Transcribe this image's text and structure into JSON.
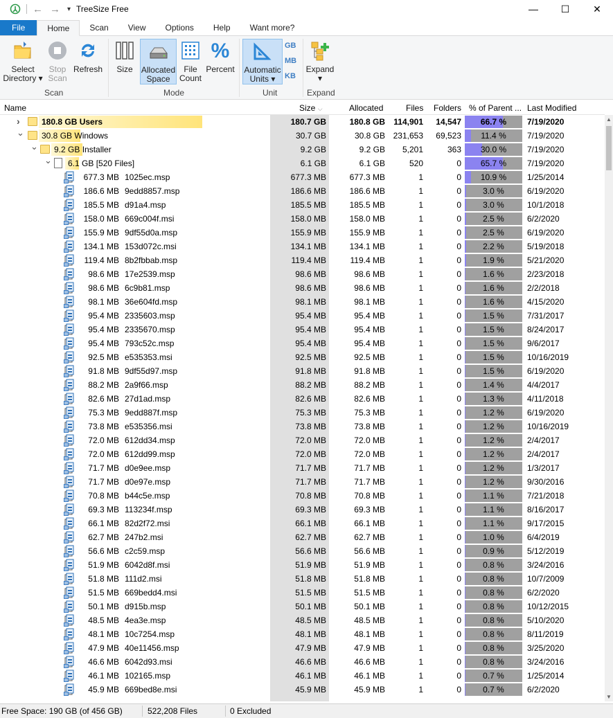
{
  "titlebar": {
    "title": "TreeSize Free",
    "back": "←",
    "forward": "→",
    "qat": "▾",
    "minimize": "—",
    "maximize": "☐",
    "close": "✕"
  },
  "tabs": [
    "File",
    "Home",
    "Scan",
    "View",
    "Options",
    "Help",
    "Want more?"
  ],
  "ribbon": {
    "select_directory": "Select\nDirectory ▾",
    "stop_scan": "Stop\nScan",
    "refresh": "Refresh",
    "size": "Size",
    "allocated_space": "Allocated\nSpace",
    "file_count": "File\nCount",
    "percent": "Percent",
    "automatic_units": "Automatic\nUnits ▾",
    "unit_gb": "GB",
    "unit_mb": "MB",
    "unit_kb": "KB",
    "expand": "Expand\n▾",
    "groups": {
      "scan": "Scan",
      "mode": "Mode",
      "unit": "Unit",
      "expand": "Expand"
    }
  },
  "columns": {
    "name": "Name",
    "size": "Size",
    "allocated": "Allocated",
    "files": "Files",
    "folders": "Folders",
    "percent": "% of Parent ...",
    "modified": "Last Modified"
  },
  "tree": [
    {
      "label": "180.8 GB  Users",
      "size": "180.7 GB",
      "allocated": "180.8 GB",
      "files": "114,901",
      "folders": "14,547",
      "percent": "66.7 %",
      "pct": 66.7,
      "modified": "7/19/2020",
      "level": 0,
      "kind": "folder",
      "expander": "›",
      "bold": true
    },
    {
      "label": "30.8 GB  Windows",
      "size": "30.7 GB",
      "allocated": "30.8 GB",
      "files": "231,653",
      "folders": "69,523",
      "percent": "11.4 %",
      "pct": 11.4,
      "modified": "7/19/2020",
      "level": 0,
      "kind": "folder",
      "expander": "⌄"
    },
    {
      "label": "9.2 GB  Installer",
      "size": "9.2 GB",
      "allocated": "9.2 GB",
      "files": "5,201",
      "folders": "363",
      "percent": "30.0 %",
      "pct": 30.0,
      "modified": "7/19/2020",
      "level": 1,
      "kind": "folder",
      "expander": "⌄"
    },
    {
      "label": "6.1 GB  [520 Files]",
      "size": "6.1 GB",
      "allocated": "6.1 GB",
      "files": "520",
      "folders": "0",
      "percent": "65.7 %",
      "pct": 65.7,
      "modified": "7/19/2020",
      "level": 2,
      "kind": "files",
      "expander": "⌄"
    }
  ],
  "files": [
    [
      "677.3 MB",
      "1025ec.msp",
      "10.9 %",
      "1/25/2014"
    ],
    [
      "186.6 MB",
      "9edd8857.msp",
      "3.0 %",
      "6/19/2020"
    ],
    [
      "185.5 MB",
      "d91a4.msp",
      "3.0 %",
      "10/1/2018"
    ],
    [
      "158.0 MB",
      "669c004f.msi",
      "2.5 %",
      "6/2/2020"
    ],
    [
      "155.9 MB",
      "9df55d0a.msp",
      "2.5 %",
      "6/19/2020"
    ],
    [
      "134.1 MB",
      "153d072c.msi",
      "2.2 %",
      "5/19/2018"
    ],
    [
      "119.4 MB",
      "8b2fbbab.msp",
      "1.9 %",
      "5/21/2020"
    ],
    [
      "98.6 MB",
      "17e2539.msp",
      "1.6 %",
      "2/23/2018"
    ],
    [
      "98.6 MB",
      "6c9b81.msp",
      "1.6 %",
      "2/2/2018"
    ],
    [
      "98.1 MB",
      "36e604fd.msp",
      "1.6 %",
      "4/15/2020"
    ],
    [
      "95.4 MB",
      "2335603.msp",
      "1.5 %",
      "7/31/2017"
    ],
    [
      "95.4 MB",
      "2335670.msp",
      "1.5 %",
      "8/24/2017"
    ],
    [
      "95.4 MB",
      "793c52c.msp",
      "1.5 %",
      "9/6/2017"
    ],
    [
      "92.5 MB",
      "e535353.msi",
      "1.5 %",
      "10/16/2019"
    ],
    [
      "91.8 MB",
      "9df55d97.msp",
      "1.5 %",
      "6/19/2020"
    ],
    [
      "88.2 MB",
      "2a9f66.msp",
      "1.4 %",
      "4/4/2017"
    ],
    [
      "82.6 MB",
      "27d1ad.msp",
      "1.3 %",
      "4/11/2018"
    ],
    [
      "75.3 MB",
      "9edd887f.msp",
      "1.2 %",
      "6/19/2020"
    ],
    [
      "73.8 MB",
      "e535356.msi",
      "1.2 %",
      "10/16/2019"
    ],
    [
      "72.0 MB",
      "612dd34.msp",
      "1.2 %",
      "2/4/2017"
    ],
    [
      "72.0 MB",
      "612dd99.msp",
      "1.2 %",
      "2/4/2017"
    ],
    [
      "71.7 MB",
      "d0e9ee.msp",
      "1.2 %",
      "1/3/2017"
    ],
    [
      "71.7 MB",
      "d0e97e.msp",
      "1.2 %",
      "9/30/2016"
    ],
    [
      "70.8 MB",
      "b44c5e.msp",
      "1.1 %",
      "7/21/2018"
    ],
    [
      "69.3 MB",
      "113234f.msp",
      "1.1 %",
      "8/16/2017"
    ],
    [
      "66.1 MB",
      "82d2f72.msi",
      "1.1 %",
      "9/17/2015"
    ],
    [
      "62.7 MB",
      "247b2.msi",
      "1.0 %",
      "6/4/2019"
    ],
    [
      "56.6 MB",
      "c2c59.msp",
      "0.9 %",
      "5/12/2019"
    ],
    [
      "51.9 MB",
      "6042d8f.msi",
      "0.8 %",
      "3/24/2016"
    ],
    [
      "51.8 MB",
      "111d2.msi",
      "0.8 %",
      "10/7/2009"
    ],
    [
      "51.5 MB",
      "669bedd4.msi",
      "0.8 %",
      "6/2/2020"
    ],
    [
      "50.1 MB",
      "d915b.msp",
      "0.8 %",
      "10/12/2015"
    ],
    [
      "48.5 MB",
      "4ea3e.msp",
      "0.8 %",
      "5/10/2020"
    ],
    [
      "48.1 MB",
      "10c7254.msp",
      "0.8 %",
      "8/11/2019"
    ],
    [
      "47.9 MB",
      "40e11456.msp",
      "0.8 %",
      "3/25/2020"
    ],
    [
      "46.6 MB",
      "6042d93.msi",
      "0.8 %",
      "3/24/2016"
    ],
    [
      "46.1 MB",
      "102165.msp",
      "0.7 %",
      "1/25/2014"
    ],
    [
      "45.9 MB",
      "669bed8e.msi",
      "0.7 %",
      "6/2/2020"
    ]
  ],
  "file_counts": {
    "files": "1",
    "folders": "0"
  },
  "status": {
    "free_space": "Free Space: 190 GB  (of 456 GB)",
    "files": "522,208 Files",
    "excluded": "0 Excluded"
  },
  "colors": {
    "accent": "#1979ca",
    "bar": "#8b83f0",
    "bar_bg": "#a0a0a0",
    "folder": "#ffe488"
  }
}
